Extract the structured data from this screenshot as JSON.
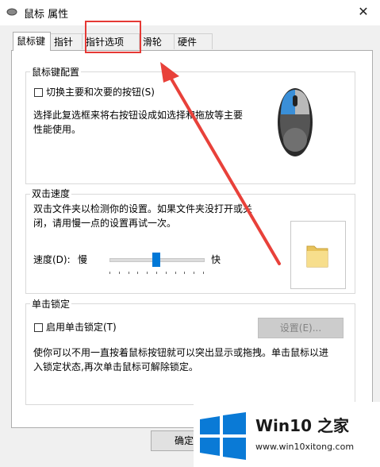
{
  "window": {
    "title": "鼠标 属性",
    "close_symbol": "✕"
  },
  "tabs": [
    {
      "label": "鼠标键",
      "active": true
    },
    {
      "label": "指针",
      "active": false
    },
    {
      "label": "指针选项",
      "active": false
    },
    {
      "label": "滑轮",
      "active": false
    },
    {
      "label": "硬件",
      "active": false
    }
  ],
  "button_config": {
    "legend": "鼠标键配置",
    "switch_checkbox_label": "切换主要和次要的按钮(S)",
    "switch_checked": false,
    "description_line1": "选择此复选框来将右按钮设成如选择和拖放等主要",
    "description_line2": "性能使用。"
  },
  "double_click": {
    "legend": "双击速度",
    "description_line1": "双击文件夹以检测你的设置。如果文件夹没打开或关",
    "description_line2": "闭，请用慢一点的设置再试一次。",
    "speed_label": "速度(D):",
    "slow_label": "慢",
    "fast_label": "快",
    "speed_level": 0.5
  },
  "click_lock": {
    "legend": "单击锁定",
    "checkbox_label": "启用单击锁定(T)",
    "checked": false,
    "settings_button": "设置(E)...",
    "description_line1": "使你可以不用一直按着鼠标按钮就可以突出显示或拖拽。单击鼠标以进",
    "description_line2": "入锁定状态,再次单击鼠标可解除锁定。"
  },
  "footer": {
    "ok_button": "确定"
  },
  "watermark": {
    "title": "Win10 之家",
    "url": "www.win10xitong.com"
  },
  "colors": {
    "accent": "#0078d7",
    "highlight": "#e53935",
    "arrow": "#e8413a"
  }
}
